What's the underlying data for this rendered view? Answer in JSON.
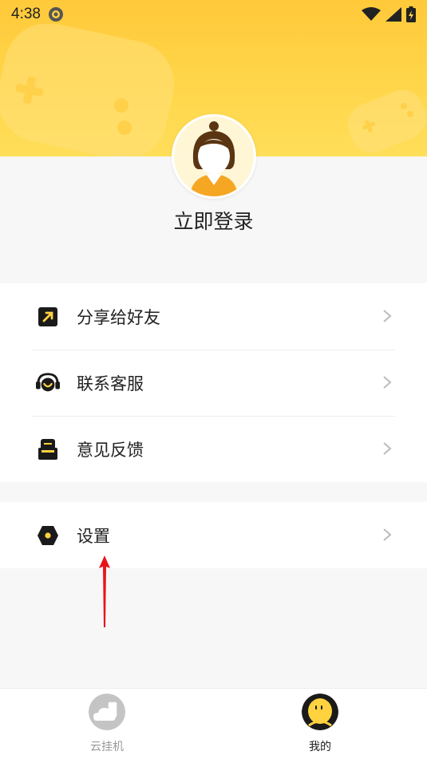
{
  "status_bar": {
    "time": "4:38"
  },
  "profile": {
    "login_label": "立即登录"
  },
  "menu": [
    {
      "label": "分享给好友",
      "icon": "share-arrow-icon"
    },
    {
      "label": "联系客服",
      "icon": "headset-icon"
    },
    {
      "label": "意见反馈",
      "icon": "feedback-icon"
    }
  ],
  "settings": {
    "label": "设置",
    "icon": "gear-hexagon-icon"
  },
  "tabbar": {
    "tabs": [
      {
        "label": "云挂机",
        "icon": "cloud-phone-icon",
        "active": false
      },
      {
        "label": "我的",
        "icon": "profile-face-icon",
        "active": true
      }
    ]
  },
  "colors": {
    "accent": "#FFD23F",
    "header_top": "#FFC93A",
    "annotation_arrow": "#E8141B"
  }
}
